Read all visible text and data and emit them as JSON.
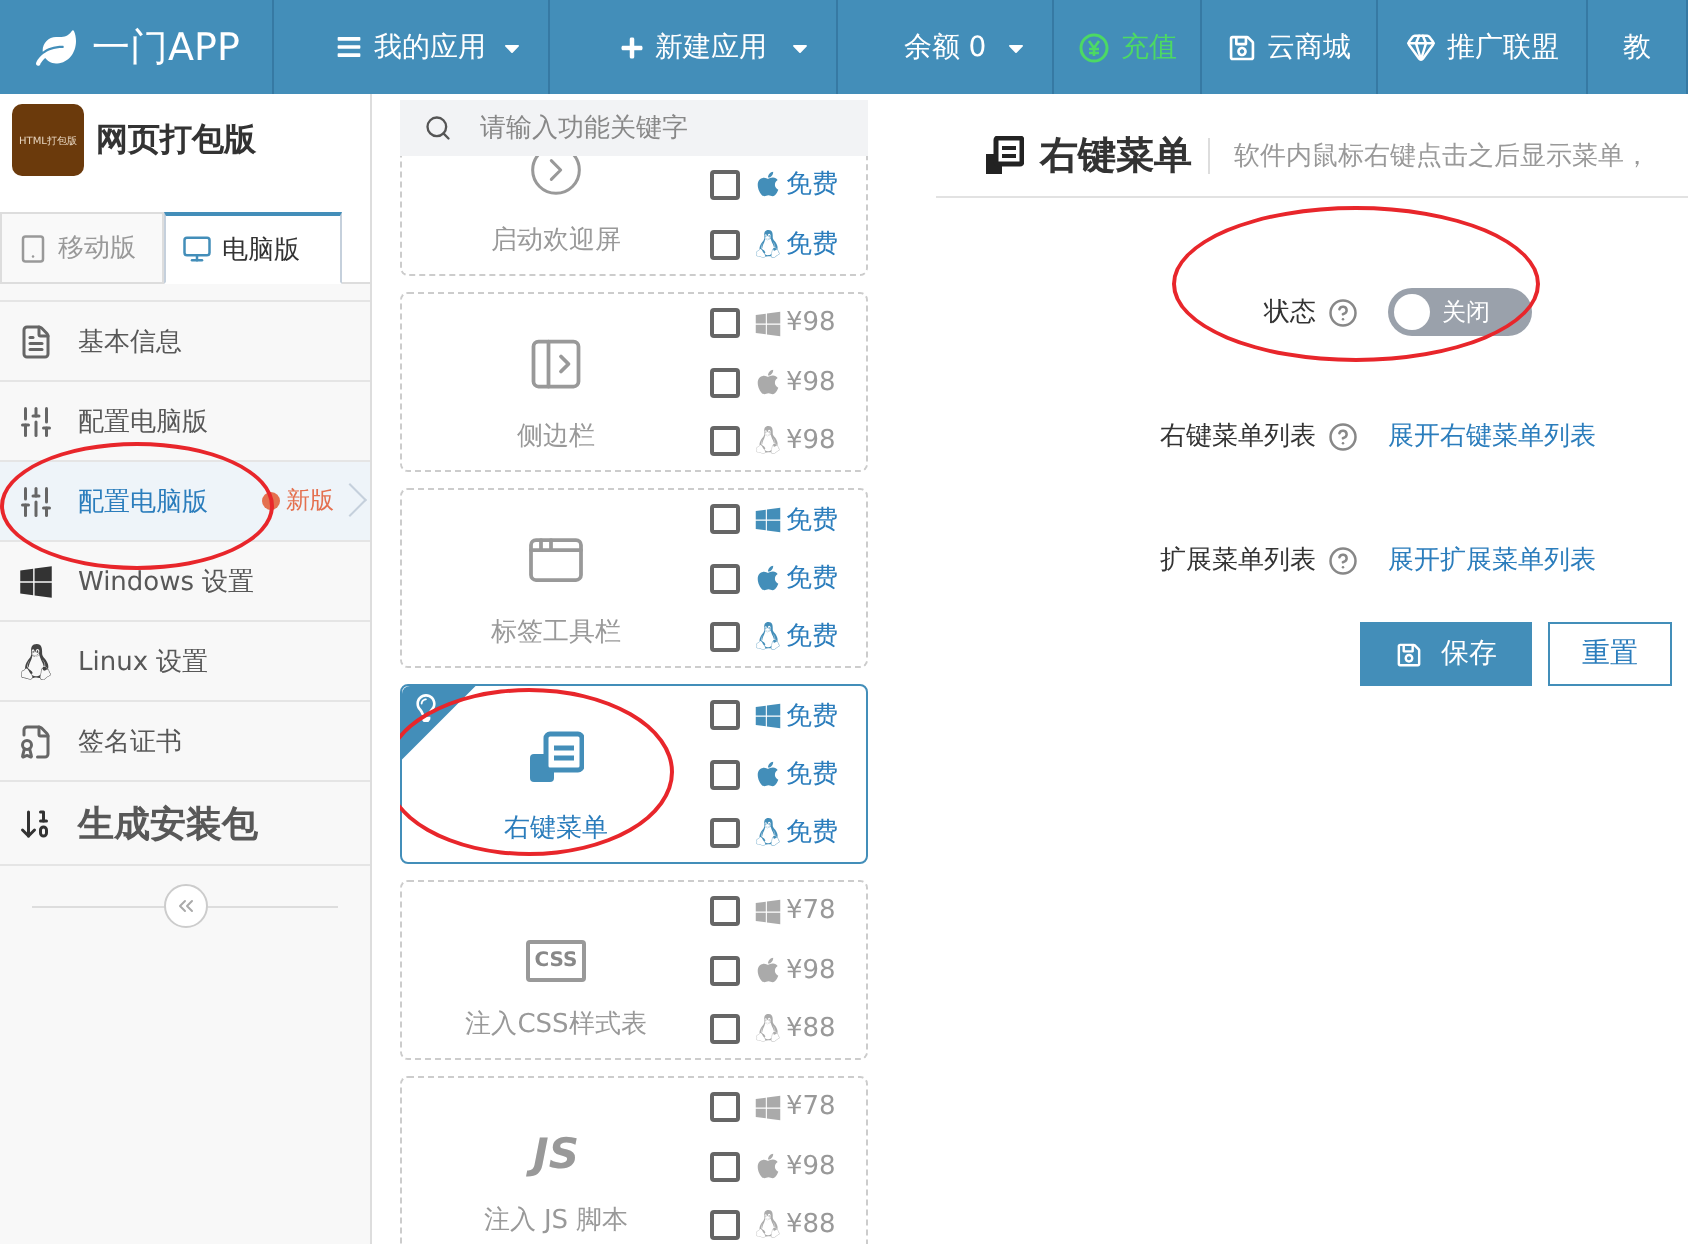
{
  "topbar": {
    "brand": "一门APP",
    "items": [
      {
        "kind": "menu",
        "label": "我的应用",
        "caret": true
      },
      {
        "kind": "new",
        "label": "新建应用",
        "caret": true
      },
      {
        "kind": "balance",
        "label": "余额 0",
        "caret": true
      },
      {
        "kind": "recharge",
        "label": "充值",
        "caret": false
      },
      {
        "kind": "store",
        "label": "云商城",
        "caret": false
      },
      {
        "kind": "affiliate",
        "label": "推广联盟",
        "caret": false
      },
      {
        "kind": "docs",
        "label": "教",
        "caret": false
      }
    ]
  },
  "sidebar": {
    "app_logo": "HTML打包版",
    "app_name": "网页打包版",
    "tabs": [
      {
        "kind": "mobile",
        "label": "移动版",
        "selected": false
      },
      {
        "kind": "desktop",
        "label": "电脑版",
        "selected": true
      }
    ],
    "items": [
      {
        "kind": "info",
        "label": "基本信息",
        "selected": false,
        "circled": false
      },
      {
        "kind": "config",
        "label": "配置电脑版",
        "selected": false,
        "circled": false
      },
      {
        "kind": "config",
        "label": "配置电脑版",
        "selected": true,
        "circled": true,
        "badge": "新版"
      },
      {
        "kind": "windows",
        "label": "Windows 设置",
        "selected": false,
        "circled": false
      },
      {
        "kind": "linux",
        "label": "Linux 设置",
        "selected": false,
        "circled": false
      },
      {
        "kind": "cert",
        "label": "签名证书",
        "selected": false,
        "circled": false
      },
      {
        "kind": "build",
        "label": "生成安装包",
        "selected": false,
        "circled": false
      }
    ]
  },
  "features": {
    "search": {
      "placeholder": "请输入功能关键字"
    },
    "cards": [
      {
        "kind": "splash",
        "label": "启动欢迎屏",
        "selected": false,
        "circled": false,
        "options": [
          {
            "kind": "mac",
            "price": "免费",
            "free": true,
            "checked": false
          },
          {
            "kind": "linux",
            "price": "免费",
            "free": true,
            "checked": false
          }
        ]
      },
      {
        "kind": "sidebar",
        "label": "侧边栏",
        "selected": false,
        "circled": false,
        "options": [
          {
            "kind": "windows",
            "price": "¥98",
            "free": false,
            "checked": false
          },
          {
            "kind": "mac",
            "price": "¥98",
            "free": false,
            "checked": false
          },
          {
            "kind": "linux",
            "price": "¥98",
            "free": false,
            "checked": false
          }
        ]
      },
      {
        "kind": "tabs",
        "label": "标签工具栏",
        "selected": false,
        "circled": false,
        "options": [
          {
            "kind": "windows",
            "price": "免费",
            "free": true,
            "checked": false
          },
          {
            "kind": "mac",
            "price": "免费",
            "free": true,
            "checked": false
          },
          {
            "kind": "linux",
            "price": "免费",
            "free": true,
            "checked": false
          }
        ]
      },
      {
        "kind": "context-menu",
        "label": "右键菜单",
        "selected": true,
        "circled": true,
        "options": [
          {
            "kind": "windows",
            "price": "免费",
            "free": true,
            "checked": false
          },
          {
            "kind": "mac",
            "price": "免费",
            "free": true,
            "checked": false
          },
          {
            "kind": "linux",
            "price": "免费",
            "free": true,
            "checked": false
          }
        ]
      },
      {
        "kind": "text-badge",
        "badge": "CSS",
        "label": "注入CSS样式表",
        "selected": false,
        "circled": false,
        "options": [
          {
            "kind": "windows",
            "price": "¥78",
            "free": false,
            "checked": false
          },
          {
            "kind": "mac",
            "price": "¥98",
            "free": false,
            "checked": false
          },
          {
            "kind": "linux",
            "price": "¥88",
            "free": false,
            "checked": false
          }
        ]
      },
      {
        "kind": "text-logo",
        "badge": "JS",
        "label": "注入 JS 脚本",
        "selected": false,
        "circled": false,
        "options": [
          {
            "kind": "windows",
            "price": "¥78",
            "free": false,
            "checked": false
          },
          {
            "kind": "mac",
            "price": "¥98",
            "free": false,
            "checked": false
          },
          {
            "kind": "linux",
            "price": "¥88",
            "free": false,
            "checked": false
          }
        ]
      }
    ]
  },
  "panel": {
    "title": "右键菜单",
    "description": "软件内鼠标右键点击之后显示菜单，",
    "fields": [
      {
        "kind": "toggle",
        "label": "状态",
        "on": false,
        "value": "关闭",
        "circled": true
      },
      {
        "kind": "link",
        "label": "右键菜单列表",
        "value": "展开右键菜单列表",
        "circled": false
      },
      {
        "kind": "link",
        "label": "扩展菜单列表",
        "value": "展开扩展菜单列表",
        "circled": false
      }
    ],
    "buttons": [
      {
        "kind": "primary",
        "label": "保存"
      },
      {
        "kind": "secondary",
        "label": "重置"
      }
    ]
  }
}
